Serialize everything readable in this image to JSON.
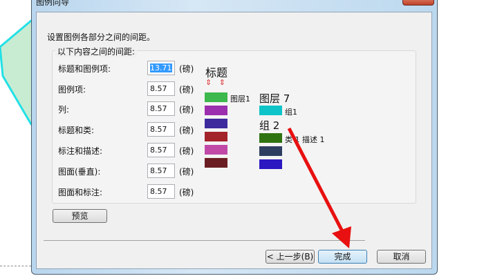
{
  "window": {
    "title": "图例向导"
  },
  "instruction": "设置图例各部分之间的间距。",
  "group_label": "以下内容之间的间距:",
  "unit": "(磅)",
  "fields": [
    {
      "label": "标题和图例项:",
      "value": "13.71"
    },
    {
      "label": "图例项:",
      "value": "8.57"
    },
    {
      "label": "列:",
      "value": "8.57"
    },
    {
      "label": "标题和类:",
      "value": "8.57"
    },
    {
      "label": "标注和描述:",
      "value": "8.57"
    },
    {
      "label": "图面(垂直):",
      "value": "8.57"
    },
    {
      "label": "图面和标注:",
      "value": "8.57"
    }
  ],
  "preview": {
    "title": "标题",
    "layer1": "图层1",
    "layer7": "图层 7",
    "group1": "组1",
    "group2": "组 2",
    "class_desc": "类 1 描述 1",
    "col1_colors": [
      "#3cb84c",
      "#9b2fae",
      "#3d2a9c",
      "#a3232b",
      "#c049a8",
      "#6a1e22"
    ],
    "col2_colors": [
      "#0fc4c8",
      "#2f7310",
      "#2d3e60",
      "#2b18c0"
    ]
  },
  "buttons": {
    "preview": "预览",
    "back": "< 上一步(B)",
    "finish": "完成",
    "cancel": "取消"
  }
}
